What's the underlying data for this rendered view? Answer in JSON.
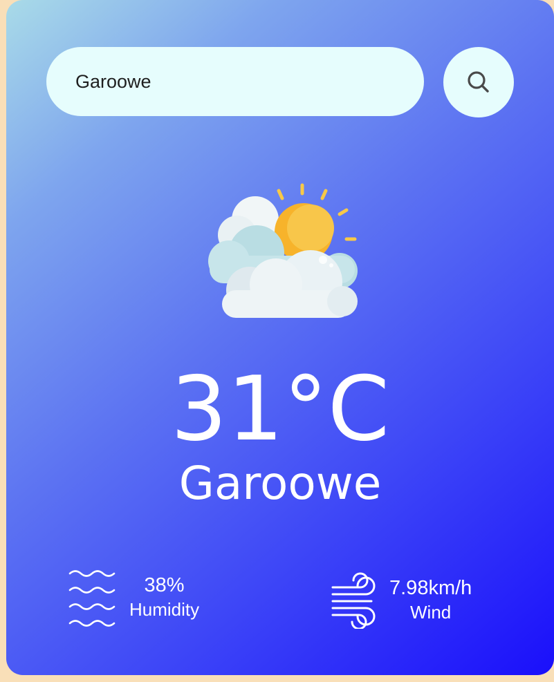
{
  "search": {
    "value": "Garoowe"
  },
  "icons": {
    "search": "search-icon",
    "weather": "partly-cloudy-sun-icon",
    "humidity": "humidity-waves-icon",
    "wind": "wind-icon"
  },
  "weather": {
    "temperature": "31°C",
    "city": "Garoowe"
  },
  "stats": {
    "humidity": {
      "value": "38%",
      "label": "Humidity"
    },
    "wind": {
      "value": "7.98km/h",
      "label": "Wind"
    }
  },
  "colors": {
    "page_background": "#f9dfb8",
    "card_gradient_start": "#a9dbe8",
    "card_gradient_end": "#1a0ffb",
    "input_background": "#e6fdfd",
    "text_primary": "#ffffff"
  }
}
